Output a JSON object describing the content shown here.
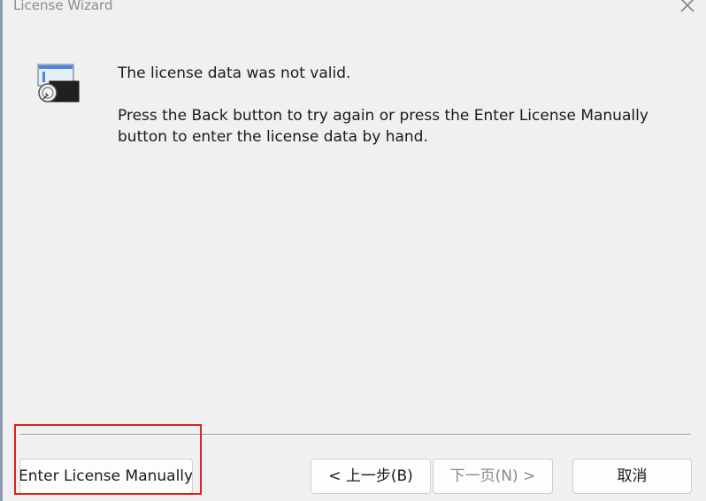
{
  "window": {
    "title": "License Wizard",
    "close_icon": "close-icon"
  },
  "content": {
    "icon": "license-app-icon",
    "message_line_1": "The license data was not valid.",
    "message_line_2a": "Press the Back button to try again or press the Enter License Manually",
    "message_line_2b": "button to enter the license data by hand."
  },
  "buttons": {
    "enter_manually": "Enter License Manually",
    "back": "< 上一步(B)",
    "next": "下一页(N) >",
    "cancel": "取消"
  },
  "states": {
    "next_enabled": false
  },
  "colors": {
    "background": "#f0f0f0",
    "highlight": "#e02020",
    "disabled_text": "#8a8a8a"
  }
}
